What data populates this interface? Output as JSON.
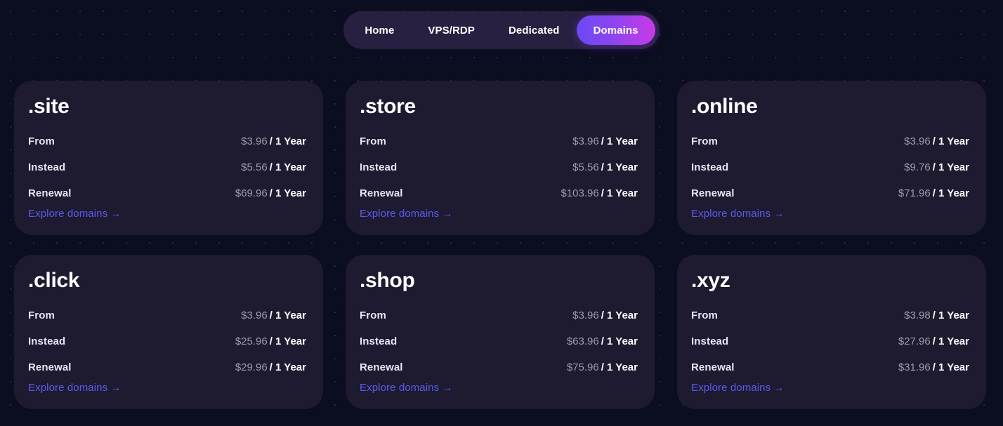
{
  "nav": {
    "items": [
      {
        "label": "Home",
        "active": false
      },
      {
        "label": "VPS/RDP",
        "active": false
      },
      {
        "label": "Dedicated",
        "active": false
      },
      {
        "label": "Domains",
        "active": true
      }
    ],
    "active_gradient_from": "#6b49f5",
    "active_gradient_to": "#c93ae8",
    "pill_background": "#272040"
  },
  "theme": {
    "page_background": "#0b0d20",
    "card_background": "#1e1a30",
    "link_color": "#5b5bef",
    "amount_color": "#9d9daa",
    "label_color": "#e6e6f0"
  },
  "labels": {
    "from": "From",
    "instead": "Instead",
    "renewal": "Renewal",
    "explore": "Explore domains",
    "arrow": "→",
    "separator": "/",
    "period": "1 Year"
  },
  "cards": [
    {
      "tld": ".site",
      "from": {
        "label": "From",
        "amount": "$3.96",
        "period": "/ 1 Year"
      },
      "instead": {
        "label": "Instead",
        "amount": "$5.56",
        "period": "/ 1 Year"
      },
      "renewal": {
        "label": "Renewal",
        "amount": "$69.96",
        "period": "/ 1 Year"
      },
      "link": "Explore domains →"
    },
    {
      "tld": ".store",
      "from": {
        "label": "From",
        "amount": "$3.96",
        "period": "/ 1 Year"
      },
      "instead": {
        "label": "Instead",
        "amount": "$5.56",
        "period": "/ 1 Year"
      },
      "renewal": {
        "label": "Renewal",
        "amount": "$103.96",
        "period": "/ 1 Year"
      },
      "link": "Explore domains →"
    },
    {
      "tld": ".online",
      "from": {
        "label": "From",
        "amount": "$3.96",
        "period": "/ 1 Year"
      },
      "instead": {
        "label": "Instead",
        "amount": "$9.76",
        "period": "/ 1 Year"
      },
      "renewal": {
        "label": "Renewal",
        "amount": "$71.96",
        "period": "/ 1 Year"
      },
      "link": "Explore domains →"
    },
    {
      "tld": ".click",
      "from": {
        "label": "From",
        "amount": "$3.96",
        "period": "/ 1 Year"
      },
      "instead": {
        "label": "Instead",
        "amount": "$25.96",
        "period": "/ 1 Year"
      },
      "renewal": {
        "label": "Renewal",
        "amount": "$29.96",
        "period": "/ 1 Year"
      },
      "link": "Explore domains →"
    },
    {
      "tld": ".shop",
      "from": {
        "label": "From",
        "amount": "$3.96",
        "period": "/ 1 Year"
      },
      "instead": {
        "label": "Instead",
        "amount": "$63.96",
        "period": "/ 1 Year"
      },
      "renewal": {
        "label": "Renewal",
        "amount": "$75.96",
        "period": "/ 1 Year"
      },
      "link": "Explore domains →"
    },
    {
      "tld": ".xyz",
      "from": {
        "label": "From",
        "amount": "$3.98",
        "period": "/ 1 Year"
      },
      "instead": {
        "label": "Instead",
        "amount": "$27.96",
        "period": "/ 1 Year"
      },
      "renewal": {
        "label": "Renewal",
        "amount": "$31.96",
        "period": "/ 1 Year"
      },
      "link": "Explore domains →"
    }
  ]
}
